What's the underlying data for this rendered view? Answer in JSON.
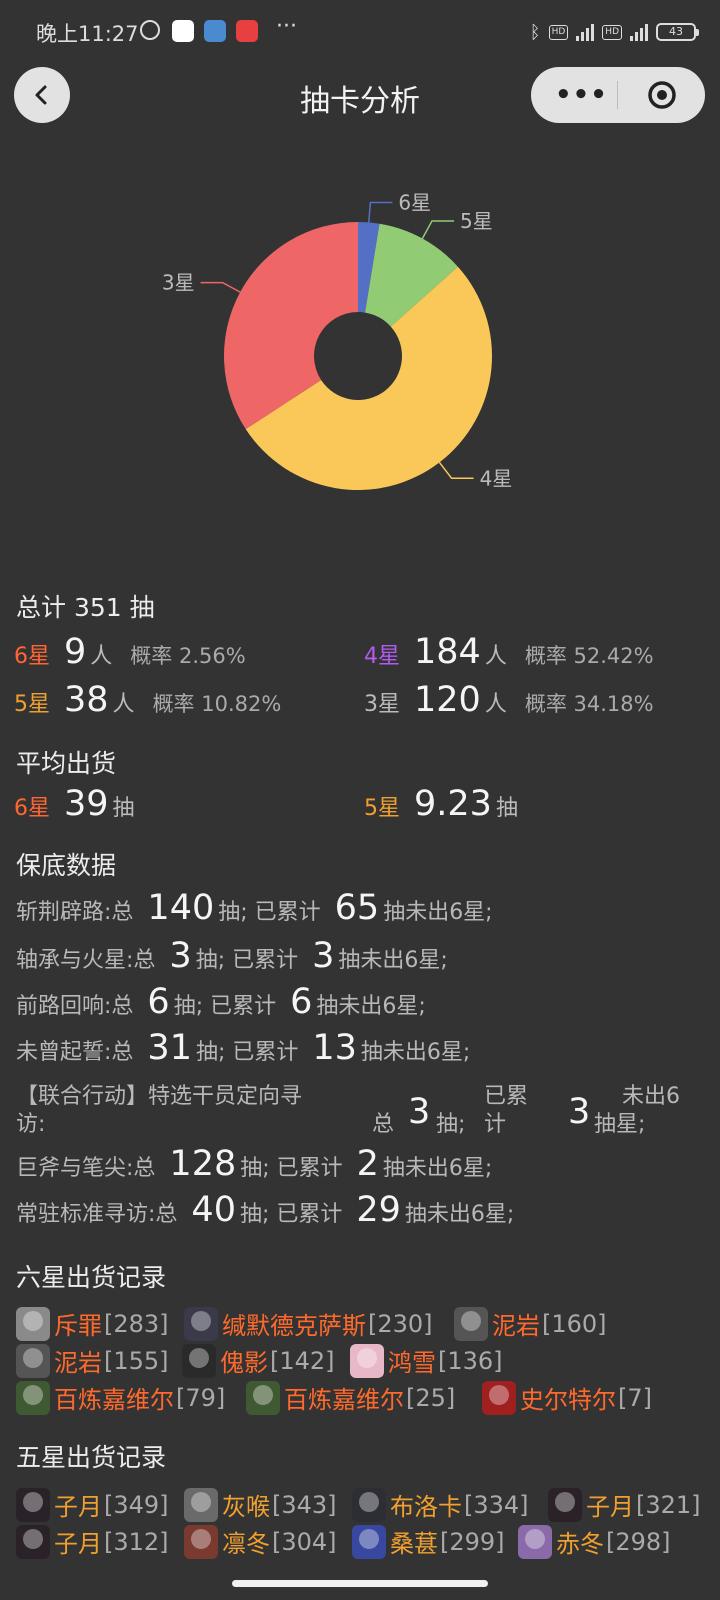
{
  "status_bar": {
    "time": "晚上11:27",
    "more": "···",
    "battery": "43"
  },
  "nav": {
    "title": "抽卡分析"
  },
  "chart_data": {
    "type": "pie",
    "donut": true,
    "categories": [
      "6星",
      "5星",
      "4星",
      "3星"
    ],
    "values": [
      9,
      38,
      184,
      120
    ],
    "colors": [
      "#5470c6",
      "#91cc75",
      "#fac858",
      "#ee6666"
    ],
    "label_color": "#bbbbbb"
  },
  "total": {
    "text": "总计 351 抽"
  },
  "stats": [
    {
      "star": "6星",
      "count": "9",
      "unit": "人",
      "prob": "概率 2.56%"
    },
    {
      "star": "4星",
      "count": "184",
      "unit": "人",
      "prob": "概率 52.42%"
    },
    {
      "star": "5星",
      "count": "38",
      "unit": "人",
      "prob": "概率 10.82%"
    },
    {
      "star": "3星",
      "count": "120",
      "unit": "人",
      "prob": "概率 34.18%"
    }
  ],
  "average": {
    "title": "平均出货",
    "items": [
      {
        "star": "6星",
        "value": "39",
        "unit": "抽"
      },
      {
        "star": "5星",
        "value": "9.23",
        "unit": "抽"
      }
    ]
  },
  "pity": {
    "title": "保底数据",
    "rows": [
      {
        "name": "斩荆辟路:总",
        "total": "140",
        "mid": "抽; 已累计",
        "acc": "65",
        "tail": "抽未出6星;"
      },
      {
        "name": "轴承与火星:总",
        "total": "3",
        "mid": "抽; 已累计",
        "acc": "3",
        "tail": "抽未出6星;"
      },
      {
        "name": "前路回响:总",
        "total": "6",
        "mid": "抽; 已累计",
        "acc": "6",
        "tail": "抽未出6星;"
      },
      {
        "name": "未曾起誓:总",
        "total": "31",
        "mid": "抽; 已累计",
        "acc": "13",
        "tail": "抽未出6星;"
      },
      {
        "name": "巨斧与笔尖:总",
        "total": "128",
        "mid": "抽; 已累计",
        "acc": "2",
        "tail": "抽未出6星;"
      },
      {
        "name": "常驻标准寻访:总",
        "total": "40",
        "mid": "抽; 已累计",
        "acc": "29",
        "tail": "抽未出6星;"
      }
    ],
    "wrapped": {
      "name_line1": "【联合行动】特选干员定向寻",
      "name_line2": "访:",
      "zong": "总",
      "total": "3",
      "chou": "抽;",
      "acc_line1": "已累",
      "acc_line2": "计",
      "acc": "3",
      "tail_line1": "未出6",
      "tail_line2": "抽星;"
    }
  },
  "six_star": {
    "title": "六星出货记录",
    "items": [
      {
        "name": "斥罪",
        "count": "[283]",
        "color": "#8a8a8a"
      },
      {
        "name": "缄默德克萨斯",
        "count": "[230]",
        "color": "#3a3a4a"
      },
      {
        "name": "泥岩",
        "count": "[160]",
        "color": "#555555"
      },
      {
        "name": "泥岩",
        "count": "[155]",
        "color": "#555555"
      },
      {
        "name": "傀影",
        "count": "[142]",
        "color": "#2a2a2a"
      },
      {
        "name": "鸿雪",
        "count": "[136]",
        "color": "#e8b8c8"
      },
      {
        "name": "百炼嘉维尔",
        "count": "[79]",
        "color": "#3f5a32"
      },
      {
        "name": "百炼嘉维尔",
        "count": "[25]",
        "color": "#3f5a32"
      },
      {
        "name": "史尔特尔",
        "count": "[7]",
        "color": "#a02020"
      }
    ]
  },
  "five_star": {
    "title": "五星出货记录",
    "items": [
      {
        "name": "子月",
        "count": "[349]",
        "color": "#2a2228"
      },
      {
        "name": "灰喉",
        "count": "[343]",
        "color": "#6a6a6a"
      },
      {
        "name": "布洛卡",
        "count": "[334]",
        "color": "#2d2d35"
      },
      {
        "name": "子月",
        "count": "[321]",
        "color": "#2a2228"
      },
      {
        "name": "子月",
        "count": "[312]",
        "color": "#2a2228"
      },
      {
        "name": "凛冬",
        "count": "[304]",
        "color": "#7a3a30"
      },
      {
        "name": "桑葚",
        "count": "[299]",
        "color": "#3848a0"
      },
      {
        "name": "赤冬",
        "count": "[298]",
        "color": "#8a6aa8"
      }
    ]
  }
}
